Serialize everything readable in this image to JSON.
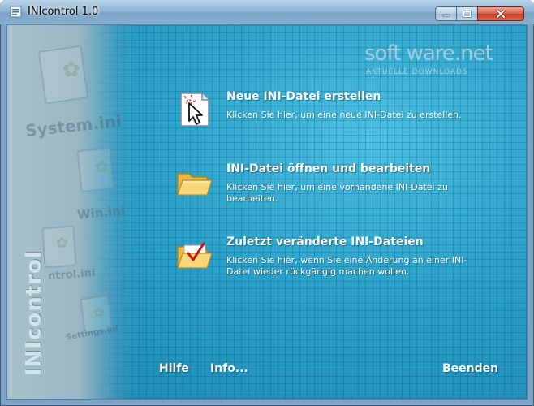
{
  "window": {
    "title": "INIcontrol 1.0",
    "controls": {
      "minimize": "minimize",
      "maximize": "maximize",
      "close": "close"
    }
  },
  "watermark": {
    "main": "soft ware.net",
    "sub": "AKTUELLE DOWNLOADS"
  },
  "sidebar": {
    "brand": "INIcontrol",
    "background_labels": [
      "System.ini",
      "Win.ini",
      "ntrol.ini",
      "Settings.ini"
    ]
  },
  "actions": [
    {
      "icon": "new-file-cursor-icon",
      "title": "Neue INI-Datei erstellen",
      "description": "Klicken Sie hier, um eine neue INI-Datei zu erstellen."
    },
    {
      "icon": "open-folder-icon",
      "title": "INI-Datei öffnen und bearbeiten",
      "description": "Klicken Sie hier, um eine vorhandene INI-Datei zu bearbeiten."
    },
    {
      "icon": "folder-checkmark-icon",
      "title": "Zuletzt veränderte INI-Dateien",
      "description": "Klicken Sie hier, wenn Sie eine Änderung an einer INI-Datei wieder rückgängig machen wollen."
    }
  ],
  "footer": {
    "help": "Hilfe",
    "info": "Info...",
    "exit": "Beenden"
  },
  "colors": {
    "accent": "#2ea0c6",
    "titlebar": "#8fb4d3",
    "close_button": "#c03c22"
  }
}
